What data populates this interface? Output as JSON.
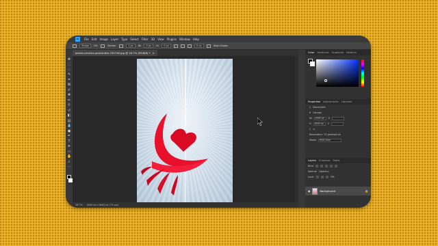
{
  "app": {
    "logo": "Ps",
    "menu": [
      "File",
      "Edit",
      "Image",
      "Layer",
      "Type",
      "Select",
      "Filter",
      "3D",
      "View",
      "Plugins",
      "Window",
      "Help"
    ]
  },
  "options_bar": {
    "items": [
      "Shape",
      "Fill:",
      "Stroke:",
      "1 px",
      "W:",
      "0 px",
      "H:",
      "0 px",
      "0 px",
      "Align Edges"
    ]
  },
  "document_tab": {
    "title": "pexels-kristina-paukshtite-704748.jpg @ 16.7% (RGB/8) *",
    "close": "×"
  },
  "status_bar": {
    "zoom": "16.7%",
    "info": "4000 px x 6000 px (72 ppi)"
  },
  "color_panel": {
    "tabs": [
      "Color",
      "Swatches",
      "Gradients",
      "Patterns"
    ]
  },
  "properties_panel": {
    "tabs": [
      "Properties",
      "Adjustments",
      "Libraries"
    ],
    "doc_label": "Document",
    "canvas_label": "Canvas",
    "w_label": "W",
    "w_value": "4000 px",
    "h_label": "H",
    "h_value": "6000 px",
    "x_label": "X",
    "y_label": "Y",
    "resolution": "Resolution: 72 pixels/inch",
    "mode_label": "Mode",
    "mode_value": "RGB Color"
  },
  "layers_panel": {
    "tabs": [
      "Layers",
      "Channels",
      "Paths"
    ],
    "kind": "Kind",
    "blend": "Normal",
    "opacity": "Opacity:",
    "lock": "Lock:",
    "fill": "Fill:",
    "layer_name": "Background"
  },
  "colors": {
    "accent": "#31a8ff",
    "background": "#e9ac1d",
    "shape_red": "#e8102a"
  }
}
